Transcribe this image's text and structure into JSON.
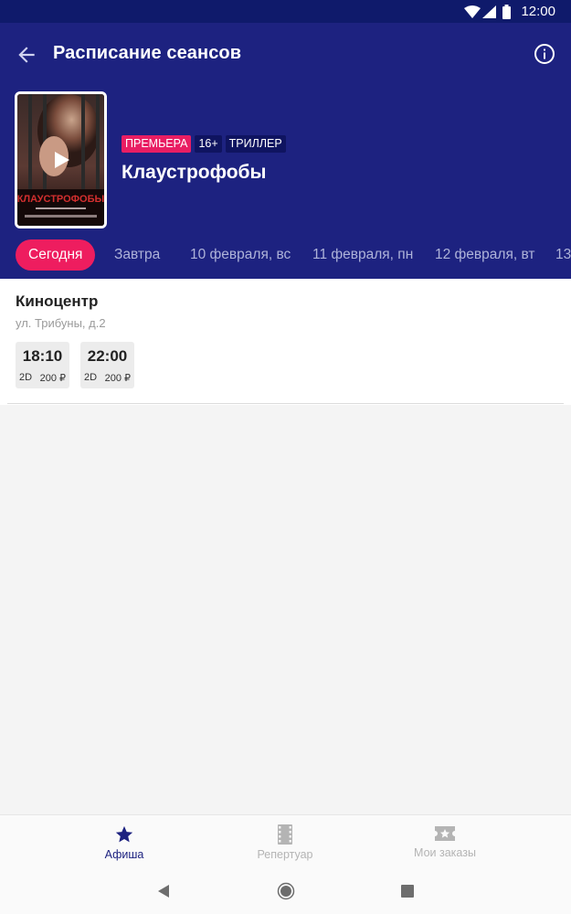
{
  "status_bar": {
    "time": "12:00"
  },
  "header": {
    "title": "Расписание сеансов"
  },
  "movie": {
    "poster_title": "КЛАУСТРОФОБЫ",
    "badges": {
      "premiere": "ПРЕМЬЕРА",
      "age": "16+",
      "genre": "ТРИЛЛЕР"
    },
    "title": "Клаустрофобы"
  },
  "dates": [
    {
      "label": "Сегодня",
      "active": true
    },
    {
      "label": "Завтра"
    },
    {
      "label": "10 февраля, вс"
    },
    {
      "label": "11 февраля, пн"
    },
    {
      "label": "12 февраля, вт"
    },
    {
      "label": "13"
    }
  ],
  "cinema": {
    "name": "Киноцентр",
    "address": "ул. Трибуны, д.2",
    "showtimes": [
      {
        "time": "18:10",
        "format": "2D",
        "price": "200 ₽"
      },
      {
        "time": "22:00",
        "format": "2D",
        "price": "200 ₽"
      }
    ]
  },
  "bottom_nav": {
    "items": [
      {
        "label": "Афиша",
        "icon": "star-icon",
        "active": true
      },
      {
        "label": "Репертуар",
        "icon": "film-icon"
      },
      {
        "label": "Мои заказы",
        "icon": "ticket-icon"
      }
    ]
  },
  "colors": {
    "header_bg": "#1d2280",
    "status_bg": "#0f1a6b",
    "accent": "#ee1d5f",
    "nav_active": "#1d2280"
  }
}
